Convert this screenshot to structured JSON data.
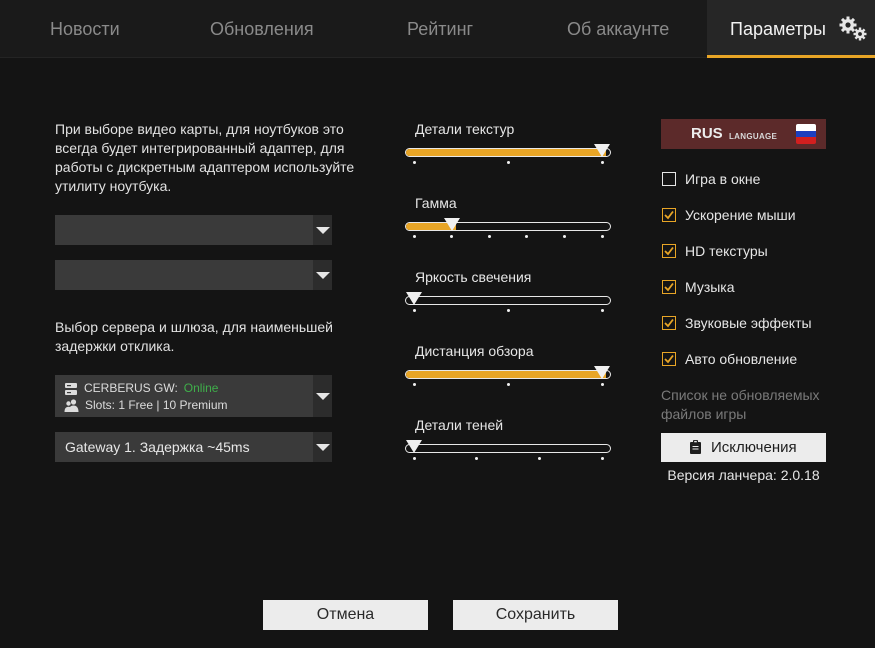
{
  "nav": {
    "tabs": [
      {
        "label": "Новости"
      },
      {
        "label": "Обновления"
      },
      {
        "label": "Рейтинг"
      },
      {
        "label": "Об аккаунте"
      },
      {
        "label": "Параметры",
        "active": true
      }
    ]
  },
  "gpu": {
    "note": "При выборе видео карты, для ноутбуков это всегда будет интегрированный адаптер, для работы с дискретным адаптером используйте утилиту ноутбука.",
    "select1_value": "",
    "select2_value": ""
  },
  "server": {
    "note": "Выбор сервера и шлюза, для наименьшей задержки отклика.",
    "name": "CERBERUS GW:",
    "status": "Online",
    "slots": "Slots: 1 Free | 10 Premium",
    "gateway": "Gateway 1. Задержка ~45ms"
  },
  "sliders": [
    {
      "label": "Детали текстур",
      "value": 1.0,
      "steps": 3
    },
    {
      "label": "Гамма",
      "value": 0.2,
      "steps": 6
    },
    {
      "label": "Яркость свечения",
      "value": 0.0,
      "steps": 3
    },
    {
      "label": "Дистанция обзора",
      "value": 1.0,
      "steps": 3
    },
    {
      "label": "Детали теней",
      "value": 0.0,
      "steps": 4
    }
  ],
  "language": {
    "code": "RUS",
    "word": "LANGUAGE",
    "flag_colors": [
      "#ffffff",
      "#1c3fbf",
      "#d21f1f"
    ]
  },
  "options": [
    {
      "label": "Игра в окне",
      "checked": false
    },
    {
      "label": "Ускорение мыши",
      "checked": true
    },
    {
      "label": "HD текстуры",
      "checked": true
    },
    {
      "label": "Музыка",
      "checked": true
    },
    {
      "label": "Звуковые эффекты",
      "checked": true
    },
    {
      "label": "Авто обновление",
      "checked": true
    }
  ],
  "exclusions": {
    "note": "Список не обновляемых файлов игры",
    "button": "Исключения"
  },
  "version": "Версия ланчера: 2.0.18",
  "buttons": {
    "cancel": "Отмена",
    "save": "Сохранить"
  },
  "colors": {
    "accent": "#e8a526",
    "online": "#3fae4a",
    "language_bg": "#5c2a2a"
  }
}
